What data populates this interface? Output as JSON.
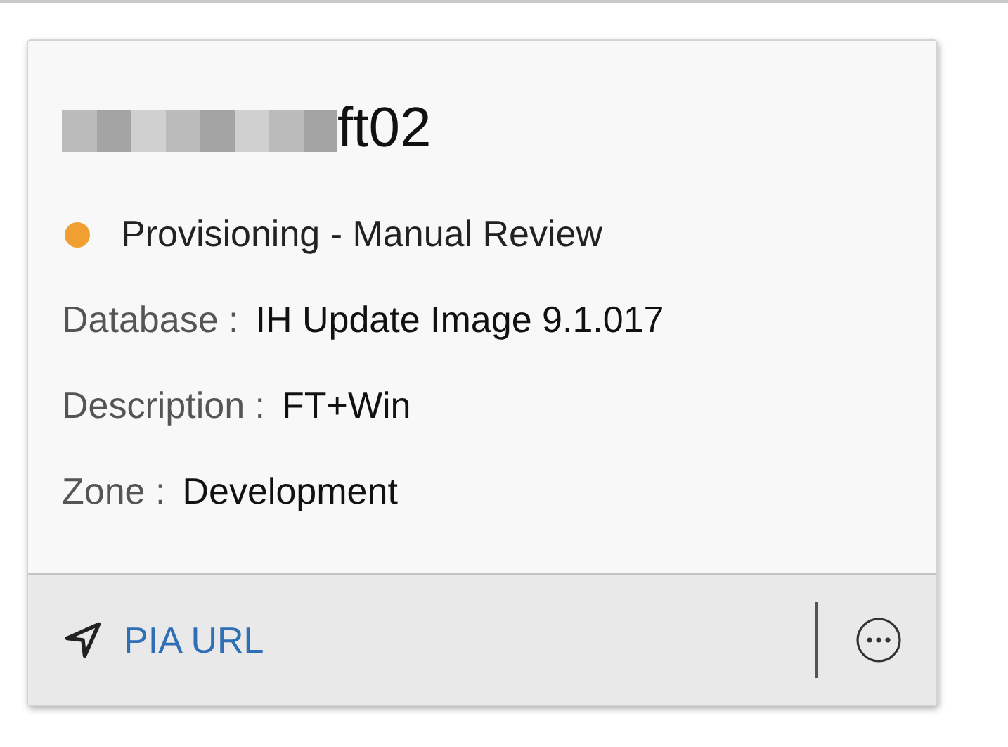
{
  "card": {
    "title": {
      "redacted": true,
      "text": "ft02"
    },
    "status": {
      "label": "Provisioning - Manual Review",
      "color": "#f0a030"
    },
    "fields": [
      {
        "label": "Database :",
        "value": "IH Update Image 9.1.017"
      },
      {
        "label": "Description :",
        "value": "FT+Win"
      },
      {
        "label": "Zone :",
        "value": "Development"
      }
    ],
    "footer": {
      "link": "PIA URL"
    }
  }
}
